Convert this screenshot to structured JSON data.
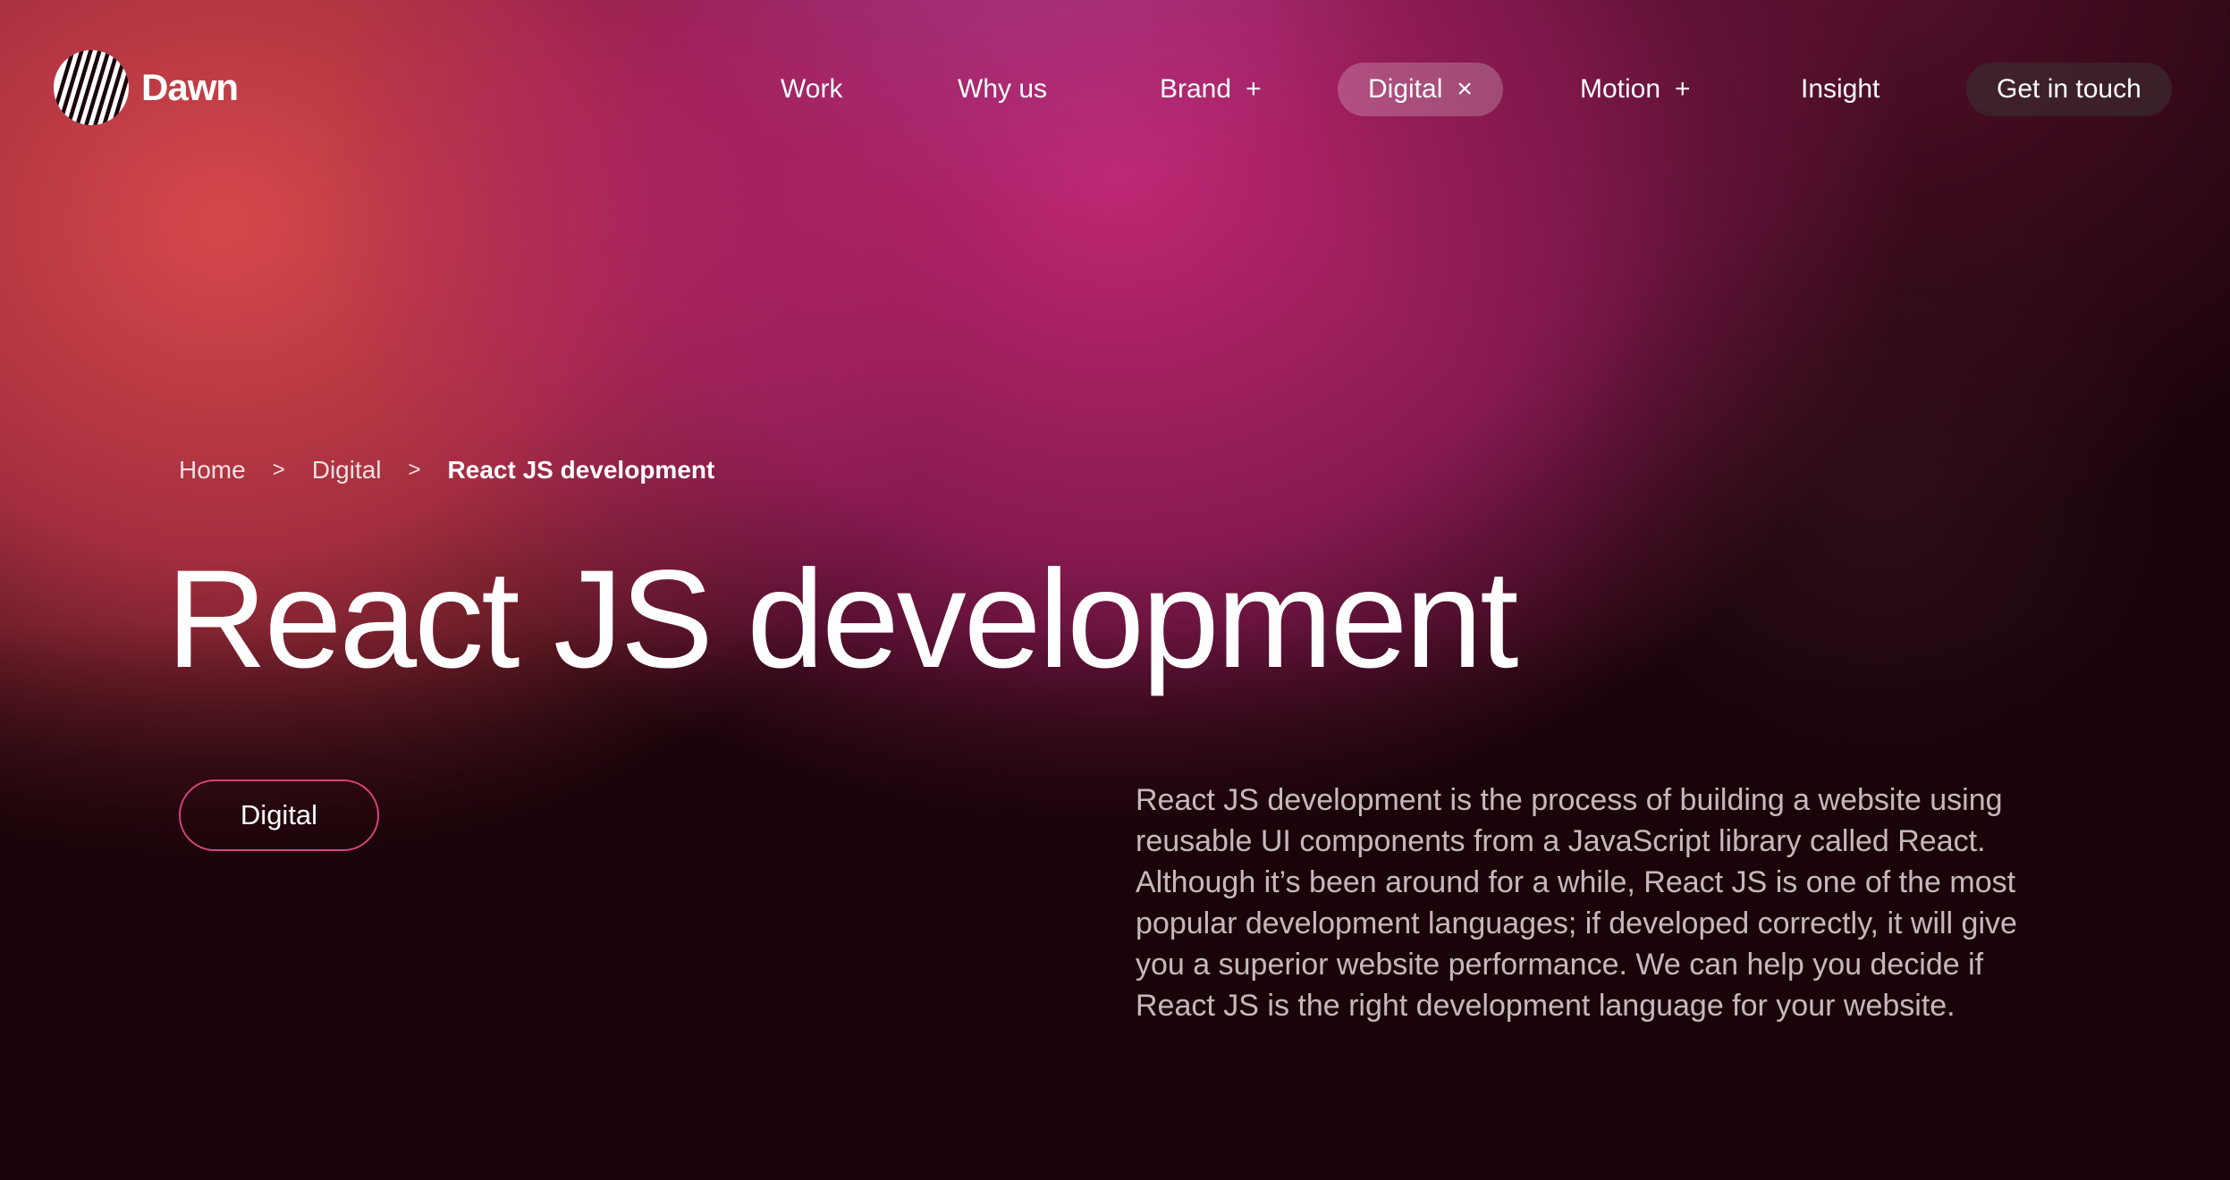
{
  "brand": {
    "name": "Dawn"
  },
  "nav": {
    "items": [
      {
        "label": "Work",
        "symbol": ""
      },
      {
        "label": "Why us",
        "symbol": ""
      },
      {
        "label": "Brand",
        "symbol": "+"
      },
      {
        "label": "Digital",
        "symbol": "×"
      },
      {
        "label": "Motion",
        "symbol": "+"
      },
      {
        "label": "Insight",
        "symbol": ""
      }
    ],
    "cta": "Get in touch"
  },
  "breadcrumb": {
    "items": [
      "Home",
      "Digital",
      "React JS development"
    ],
    "separator": ">"
  },
  "hero": {
    "title": "React JS development",
    "tag": "Digital",
    "description": "React JS development is the process of building a website using reusable UI components from a JavaScript library called React. Although it’s been around for a while, React JS is one of the most popular development languages; if developed correctly, it will give you a superior website performance. We can help you decide if React JS is the right development language for your website."
  },
  "colors": {
    "background": "#1a0409",
    "accent_pink": "#d9427f",
    "warm_red": "#e04c4e",
    "magenta": "#c8287a"
  },
  "icons": {
    "logo": "striped-sun-logo-icon",
    "expand": "plus-icon",
    "collapse": "close-icon",
    "breadcrumb_separator": "chevron-right-icon"
  }
}
